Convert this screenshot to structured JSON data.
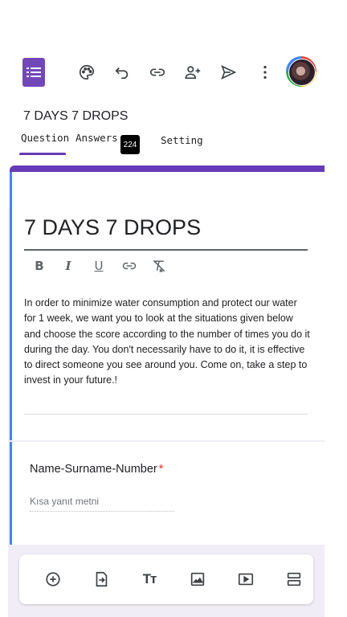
{
  "toolbar": {
    "icons": [
      "forms-logo",
      "palette-icon",
      "undo-icon",
      "link-icon",
      "add-collaborator-icon",
      "send-icon",
      "more-vert-icon",
      "avatar"
    ]
  },
  "header": {
    "form_title": "7 DAYS 7 DROPS",
    "tabs": [
      {
        "label": "Question",
        "active": true
      },
      {
        "label": "Answers",
        "active": false
      },
      {
        "label": "Setting",
        "active": false
      }
    ],
    "answers_badge": "224"
  },
  "header_card": {
    "title": "7 DAYS 7 DROPS",
    "format_buttons": [
      "B",
      "I",
      "U",
      "link",
      "clear-format"
    ],
    "description": "In order to minimize water consumption and protect our water for 1 week, we want you to look at the situations given below and choose the score according to the number of times you do it during the day. You don't necessarily have to do it, it is effective to direct someone you see around you. Come on, take a step to invest in your future.!"
  },
  "question_card": {
    "title": "Name-Surname-Number",
    "required_marker": "*",
    "placeholder": "Kısa yanıt metni"
  },
  "bottom_toolbar": {
    "icons": [
      "add-question-icon",
      "import-questions-icon",
      "add-title-icon",
      "add-image-icon",
      "add-video-icon",
      "add-section-icon"
    ]
  },
  "colors": {
    "accent": "#673ab7",
    "forms_logo": "#7248b9",
    "left_bar": "#4285f4",
    "background": "#f1edf7",
    "required": "#d93025"
  }
}
